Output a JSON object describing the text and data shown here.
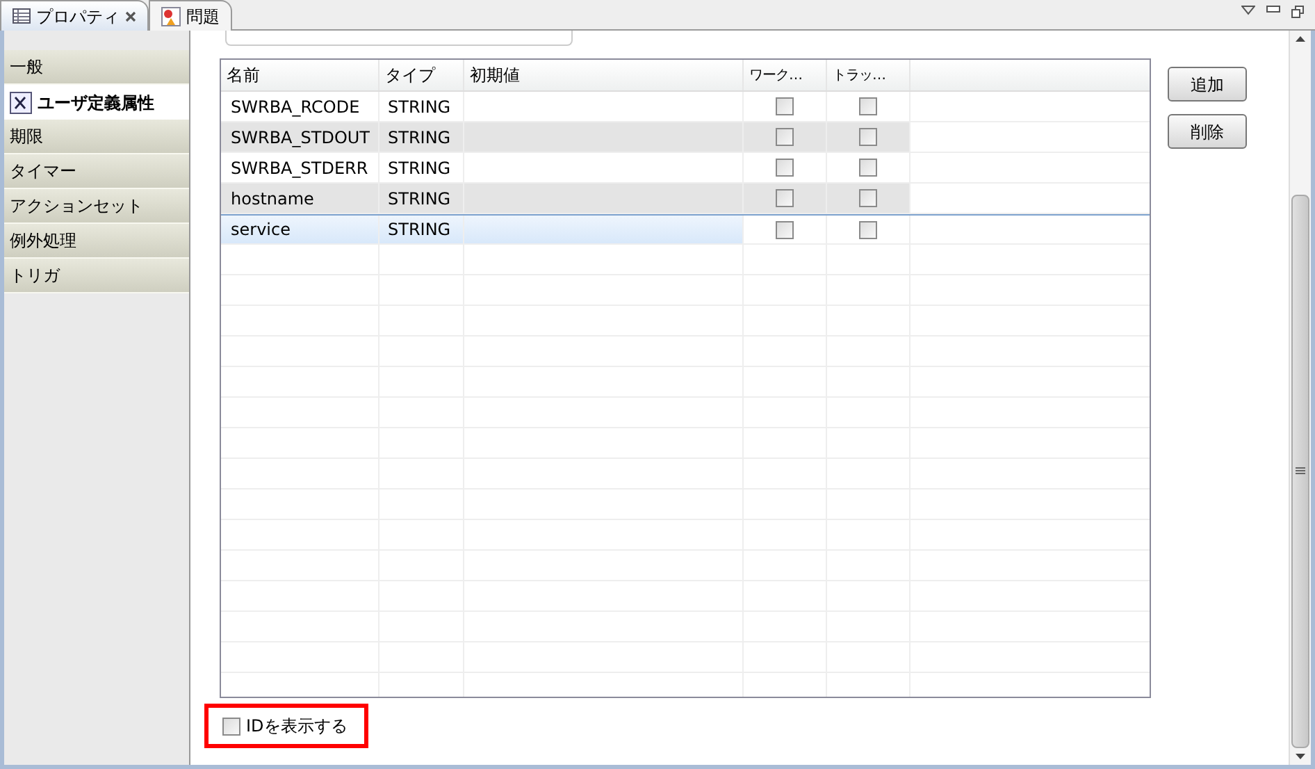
{
  "tabs": [
    {
      "label": "プロパティ",
      "selected": true,
      "closable": true
    },
    {
      "label": "問題",
      "selected": false,
      "closable": false
    }
  ],
  "sidebar": {
    "items": [
      {
        "label": "一般",
        "selected": false
      },
      {
        "label": "ユーザ定義属性",
        "selected": true
      },
      {
        "label": "期限",
        "selected": false
      },
      {
        "label": "タイマー",
        "selected": false
      },
      {
        "label": "アクションセット",
        "selected": false
      },
      {
        "label": "例外処理",
        "selected": false
      },
      {
        "label": "トリガ",
        "selected": false
      }
    ]
  },
  "table": {
    "columns": [
      "名前",
      "タイプ",
      "初期値",
      "ワーク…",
      "トラッ…"
    ],
    "rows": [
      {
        "name": "SWRBA_RCODE",
        "type": "STRING",
        "work": false,
        "track": false,
        "selected": false
      },
      {
        "name": "SWRBA_STDOUT",
        "type": "STRING",
        "work": false,
        "track": false,
        "selected": false
      },
      {
        "name": "SWRBA_STDERR",
        "type": "STRING",
        "work": false,
        "track": false,
        "selected": false
      },
      {
        "name": "hostname",
        "type": "STRING",
        "work": false,
        "track": false,
        "selected": false
      },
      {
        "name": "service",
        "type": "STRING",
        "work": false,
        "track": false,
        "selected": true
      }
    ]
  },
  "buttons": [
    "追加",
    "削除"
  ],
  "show_id": {
    "label": "IDを表示する",
    "checked": false
  }
}
